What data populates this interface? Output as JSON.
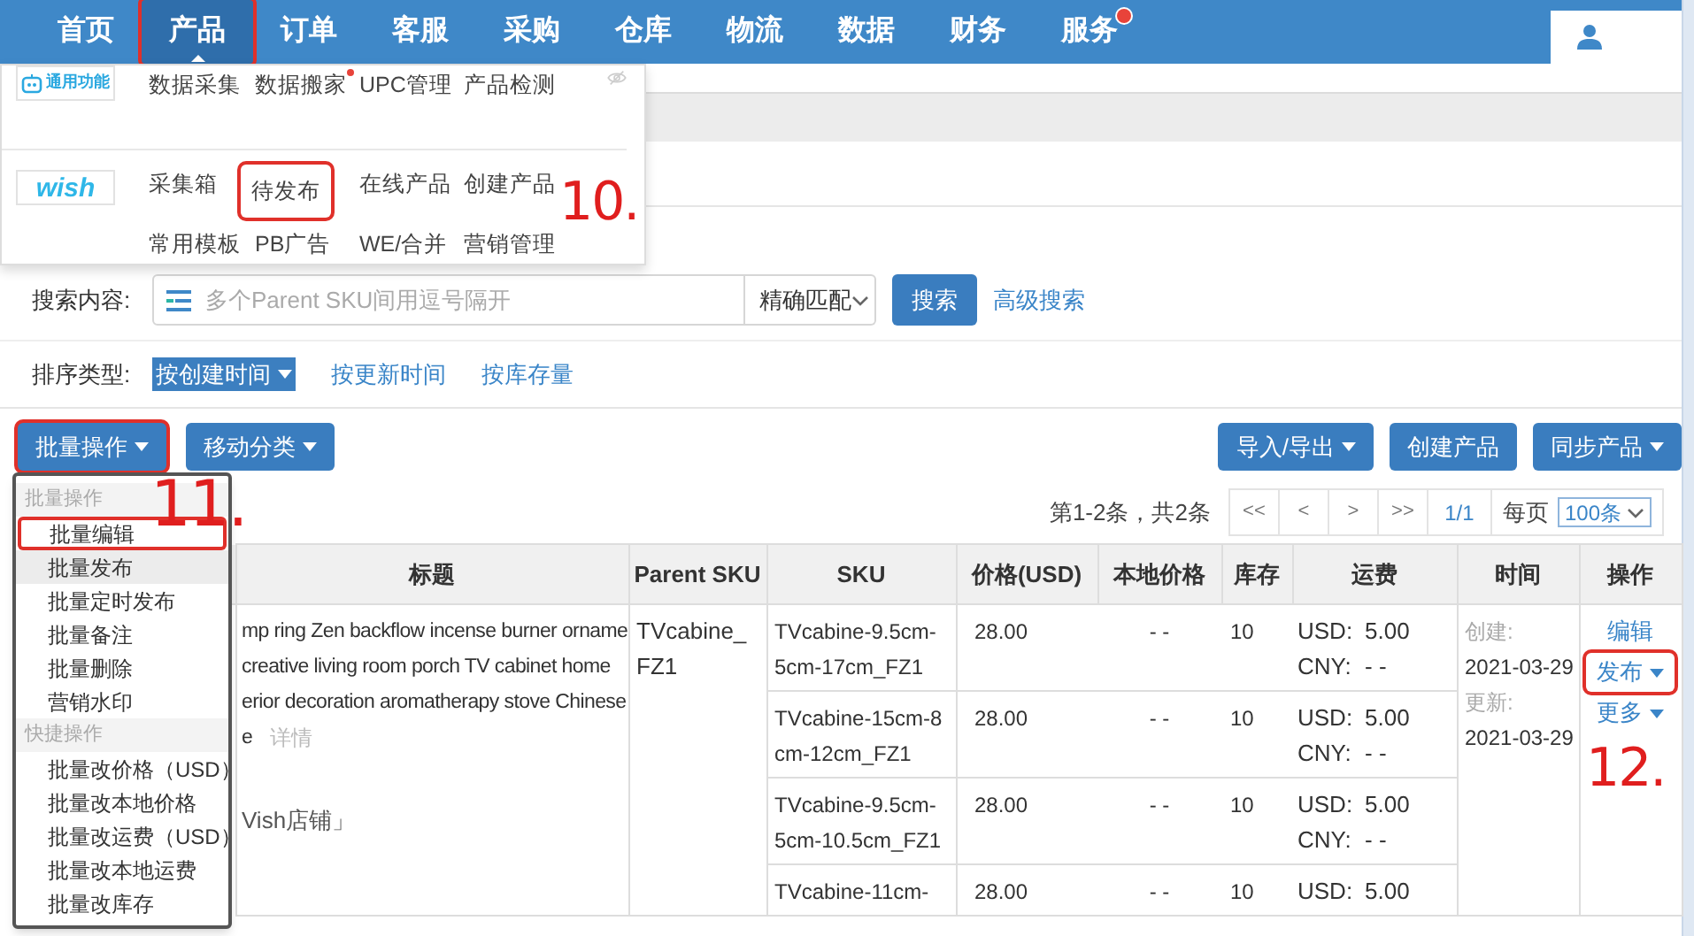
{
  "nav": {
    "items": [
      {
        "label": "首页",
        "selected": false,
        "badge": false,
        "highlighted": false
      },
      {
        "label": "产品",
        "selected": true,
        "badge": false,
        "highlighted": true
      },
      {
        "label": "订单",
        "selected": false,
        "badge": false,
        "highlighted": false
      },
      {
        "label": "客服",
        "selected": false,
        "badge": false,
        "highlighted": false
      },
      {
        "label": "采购",
        "selected": false,
        "badge": false,
        "highlighted": false
      },
      {
        "label": "仓库",
        "selected": false,
        "badge": false,
        "highlighted": false
      },
      {
        "label": "物流",
        "selected": false,
        "badge": false,
        "highlighted": false
      },
      {
        "label": "数据",
        "selected": false,
        "badge": false,
        "highlighted": false
      },
      {
        "label": "财务",
        "selected": false,
        "badge": false,
        "highlighted": false
      },
      {
        "label": "服务",
        "selected": false,
        "badge": true,
        "highlighted": false
      }
    ]
  },
  "product_menu": {
    "groups": [
      {
        "kind": "general",
        "logo": "通用功能",
        "items": [
          {
            "label": "数据采集",
            "badge": false,
            "highlighted": false
          },
          {
            "label": "数据搬家",
            "badge": true,
            "highlighted": false
          },
          {
            "label": "UPC管理",
            "badge": false,
            "highlighted": false
          },
          {
            "label": "产品检测",
            "badge": false,
            "highlighted": false
          }
        ]
      },
      {
        "kind": "wish",
        "logo": "wish",
        "items": [
          {
            "label": "采集箱",
            "badge": false,
            "highlighted": false
          },
          {
            "label": "待发布",
            "badge": false,
            "highlighted": true
          },
          {
            "label": "在线产品",
            "badge": false,
            "highlighted": false
          },
          {
            "label": "创建产品",
            "badge": false,
            "highlighted": false
          },
          {
            "label": "常用模板",
            "badge": false,
            "highlighted": false
          },
          {
            "label": "PB广告",
            "badge": false,
            "highlighted": false
          },
          {
            "label": "WE/合并",
            "badge": false,
            "highlighted": false
          },
          {
            "label": "营销管理",
            "badge": false,
            "highlighted": false
          }
        ]
      }
    ]
  },
  "search": {
    "label": "搜索内容:",
    "placeholder": "多个Parent SKU间用逗号隔开",
    "match": "精确匹配",
    "button": "搜索",
    "advanced": "高级搜索"
  },
  "sort": {
    "label": "排序类型:",
    "options": [
      {
        "label": "按创建时间",
        "selected": true
      },
      {
        "label": "按更新时间",
        "selected": false
      },
      {
        "label": "按库存量",
        "selected": false
      }
    ]
  },
  "toolbar": {
    "left": [
      {
        "label": "批量操作",
        "dropdown": true,
        "highlighted": true
      },
      {
        "label": "移动分类",
        "dropdown": true,
        "highlighted": false
      }
    ],
    "right": [
      {
        "label": "导入/导出",
        "dropdown": true,
        "highlighted": false
      },
      {
        "label": "创建产品",
        "dropdown": false,
        "highlighted": false
      },
      {
        "label": "同步产品",
        "dropdown": true,
        "highlighted": false
      }
    ]
  },
  "pagination": {
    "summary": "第1-2条，共2条",
    "buttons": [
      "<<",
      "<",
      ">",
      ">>"
    ],
    "page": "1/1",
    "per_page_label": "每页",
    "per_page": "100条"
  },
  "bulk_menu": {
    "sections": [
      {
        "header": "批量操作",
        "items": [
          {
            "label": "批量编辑",
            "hovered": false,
            "highlighted": true
          },
          {
            "label": "批量发布",
            "hovered": true,
            "highlighted": false
          },
          {
            "label": "批量定时发布",
            "hovered": false,
            "highlighted": false
          },
          {
            "label": "批量备注",
            "hovered": false,
            "highlighted": false
          },
          {
            "label": "批量删除",
            "hovered": false,
            "highlighted": false
          },
          {
            "label": "营销水印",
            "hovered": false,
            "highlighted": false
          }
        ]
      },
      {
        "header": "快捷操作",
        "items": [
          {
            "label": "批量改价格（USD）",
            "hovered": false,
            "highlighted": false
          },
          {
            "label": "批量改本地价格",
            "hovered": false,
            "highlighted": false
          },
          {
            "label": "批量改运费（USD）",
            "hovered": false,
            "highlighted": false
          },
          {
            "label": "批量改本地运费",
            "hovered": false,
            "highlighted": false
          },
          {
            "label": "批量改库存",
            "hovered": false,
            "highlighted": false
          }
        ]
      }
    ]
  },
  "table": {
    "columns": [
      "标题",
      "Parent SKU",
      "SKU",
      "价格(USD)",
      "本地价格",
      "库存",
      "运费",
      "时间",
      "操作"
    ],
    "products": [
      {
        "title_lines": [
          "mp ring Zen backflow incense burner orname",
          "creative living room porch TV cabinet home",
          "erior decoration aromatherapy stove Chinese",
          "e"
        ],
        "detail_link": "详情",
        "store": "Vish店铺」",
        "parent_sku": "TVcabine_FZ1",
        "variants": [
          {
            "sku": "TVcabine-9.5cm-5cm-17cm_FZ1",
            "price": "28.00",
            "local_price": "- -",
            "stock": "10",
            "shipping": [
              {
                "currency": "USD:",
                "amount": "5.00"
              },
              {
                "currency": "CNY:",
                "amount": "- -"
              }
            ]
          },
          {
            "sku": "TVcabine-15cm-8cm-12cm_FZ1",
            "price": "28.00",
            "local_price": "- -",
            "stock": "10",
            "shipping": [
              {
                "currency": "USD:",
                "amount": "5.00"
              },
              {
                "currency": "CNY:",
                "amount": "- -"
              }
            ]
          },
          {
            "sku": "TVcabine-9.5cm-5cm-10.5cm_FZ1",
            "price": "28.00",
            "local_price": "- -",
            "stock": "10",
            "shipping": [
              {
                "currency": "USD:",
                "amount": "5.00"
              },
              {
                "currency": "CNY:",
                "amount": "- -"
              }
            ]
          },
          {
            "sku": "TVcabine-11cm-",
            "price": "28.00",
            "local_price": "- -",
            "stock": "10",
            "shipping": [
              {
                "currency": "USD:",
                "amount": "5.00"
              }
            ]
          }
        ],
        "created_label": "创建:",
        "created": "2021-03-29",
        "updated_label": "更新:",
        "updated": "2021-03-29",
        "actions": [
          {
            "label": "编辑",
            "dropdown": false,
            "highlighted": false
          },
          {
            "label": "发布",
            "dropdown": true,
            "highlighted": true
          },
          {
            "label": "更多",
            "dropdown": true,
            "highlighted": false
          }
        ]
      }
    ]
  },
  "step_labels": [
    "10.",
    "11.",
    "12."
  ]
}
